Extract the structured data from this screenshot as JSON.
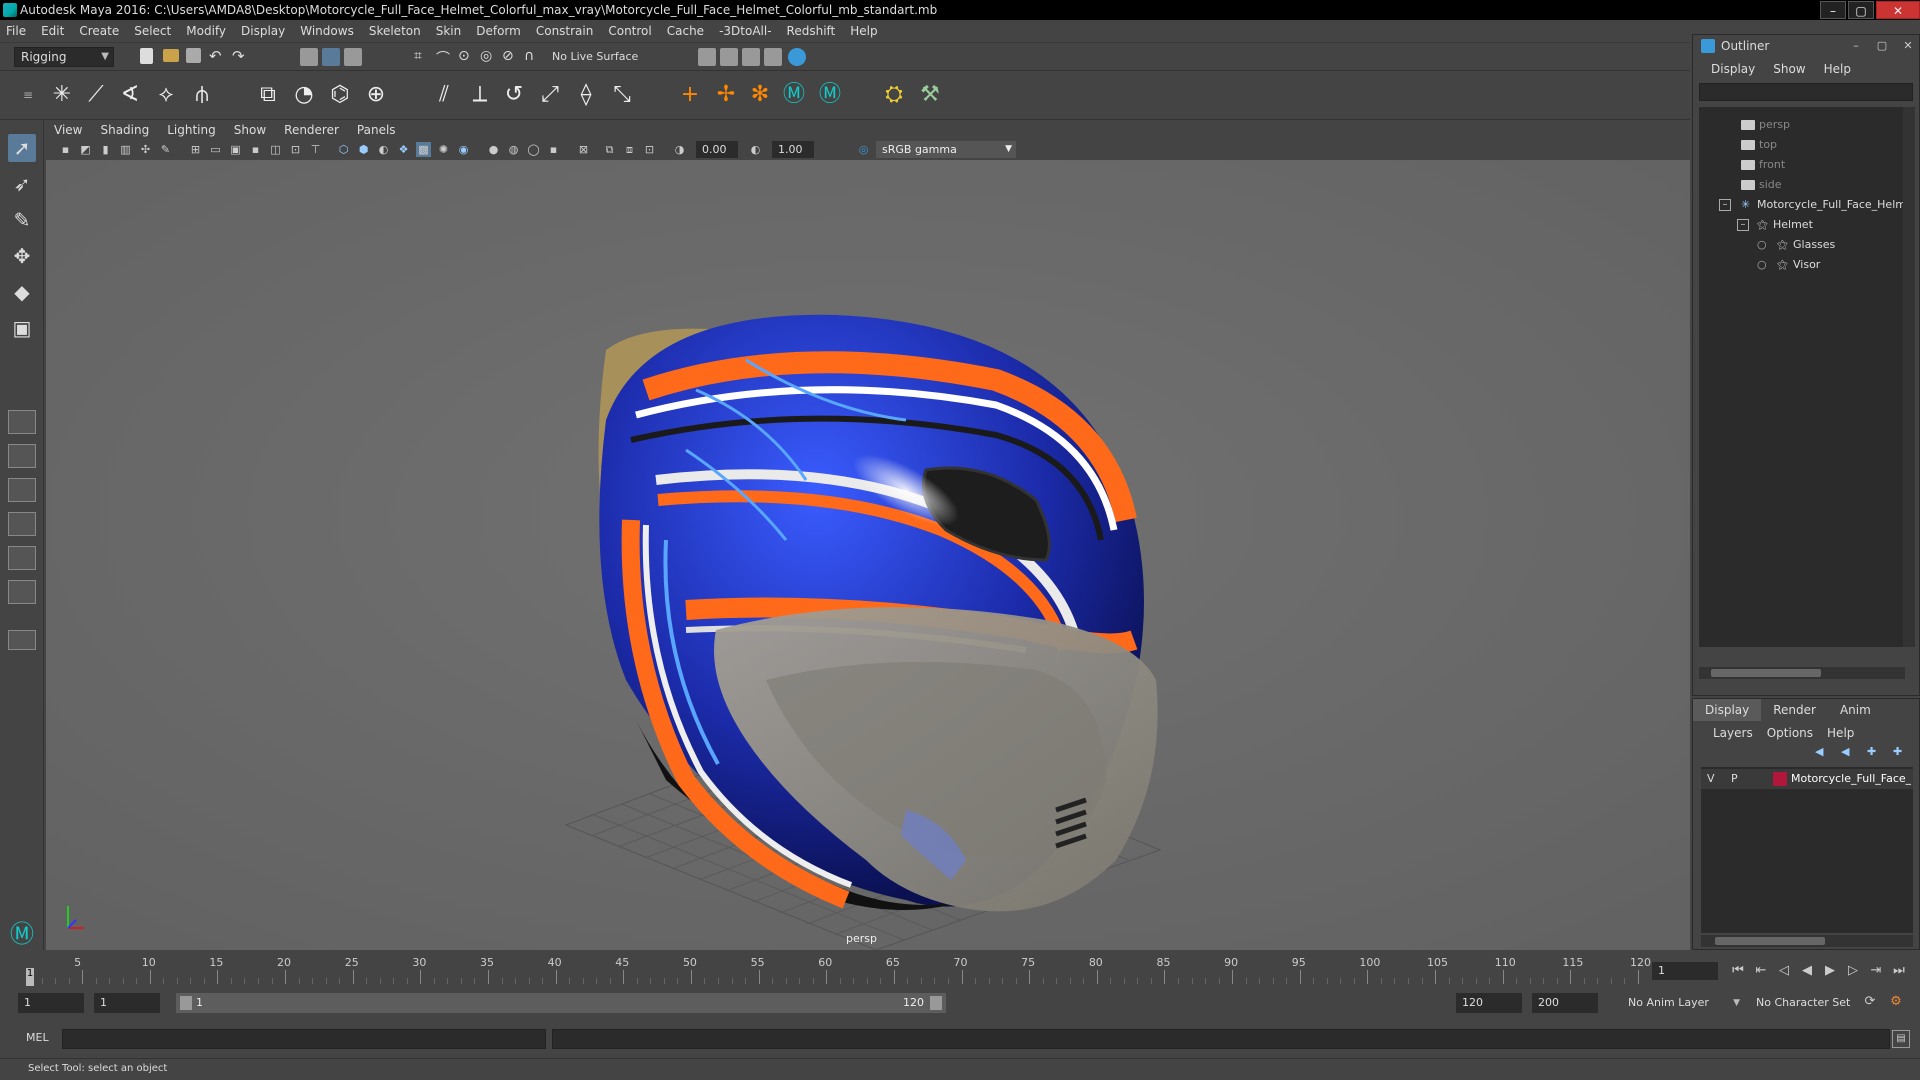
{
  "window": {
    "title": "Autodesk Maya 2016: C:\\Users\\AMDA8\\Desktop\\Motorcycle_Full_Face_Helmet_Colorful_max_vray\\Motorcycle_Full_Face_Helmet_Colorful_mb_standart.mb"
  },
  "menubar": [
    "File",
    "Edit",
    "Create",
    "Select",
    "Modify",
    "Display",
    "Windows",
    "Skeleton",
    "Skin",
    "Deform",
    "Constrain",
    "Control",
    "Cache",
    "-3DtoAll-",
    "Redshift",
    "Help"
  ],
  "statusline": {
    "mode": "Rigging",
    "live_surface": "No Live Surface"
  },
  "viewport": {
    "menu": [
      "View",
      "Shading",
      "Lighting",
      "Show",
      "Renderer",
      "Panels"
    ],
    "exposure": "0.00",
    "gamma": "1.00",
    "color_space": "sRGB gamma",
    "camera_label": "persp"
  },
  "outliner": {
    "title": "Outliner",
    "menu": [
      "Display",
      "Show",
      "Help"
    ],
    "items": [
      {
        "label": "persp"
      },
      {
        "label": "top"
      },
      {
        "label": "front"
      },
      {
        "label": "side"
      },
      {
        "label": "Motorcycle_Full_Face_Helmet_Colorful"
      },
      {
        "label": "Helmet"
      },
      {
        "label": "Glasses"
      },
      {
        "label": "Visor"
      }
    ]
  },
  "layer_editor": {
    "tabs": [
      "Display",
      "Render",
      "Anim"
    ],
    "menu": [
      "Layers",
      "Options",
      "Help"
    ],
    "layer": {
      "v": "V",
      "p": "P",
      "name": "Motorcycle_Full_Face_Helmet_Colorful",
      "color": "#b0173a"
    }
  },
  "timeslider": {
    "ticks": [
      "1",
      "5",
      "10",
      "15",
      "20",
      "25",
      "30",
      "35",
      "40",
      "45",
      "50",
      "55",
      "60",
      "65",
      "70",
      "75",
      "80",
      "85",
      "90",
      "95",
      "100",
      "105",
      "110",
      "115",
      "120"
    ],
    "cursor_label": "1",
    "current_frame": "1"
  },
  "range": {
    "start": "1",
    "playback_start": "1",
    "slider_start": "1",
    "slider_end": "120",
    "playback_end": "120",
    "end": "200",
    "anim_layer": "No Anim Layer",
    "character_set": "No Character Set"
  },
  "cmdline": {
    "label": "MEL"
  },
  "helpline": {
    "text": "Select Tool: select an object"
  }
}
